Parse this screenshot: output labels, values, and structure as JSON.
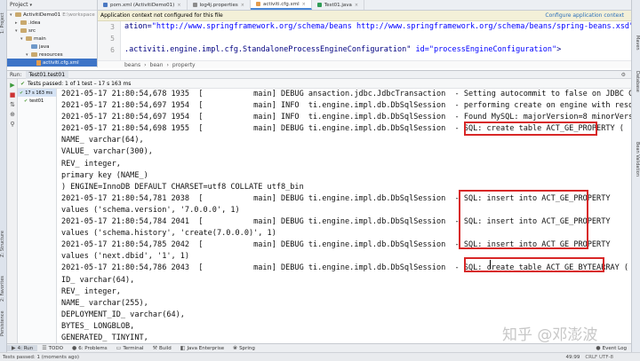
{
  "left_strip": {
    "top_tab": "1: Project",
    "structure_tab": "Z: Structure",
    "favorites_tab": "2: Favorites",
    "persistence_tab": "Persistence"
  },
  "right_strip": {
    "maven": "Maven",
    "database": "Database",
    "bean_validation": "Bean Validation"
  },
  "project": {
    "header": "Project",
    "tree": [
      {
        "label": "ActivitiDemo01",
        "dim": "E:\\workspace",
        "kind": "module",
        "arrow": "▾"
      },
      {
        "label": ".idea",
        "kind": "folder",
        "arrow": "▸"
      },
      {
        "label": "src",
        "kind": "folder",
        "arrow": "▾"
      },
      {
        "label": "main",
        "kind": "folder",
        "arrow": "▾"
      },
      {
        "label": "java",
        "kind": "blue",
        "arrow": ""
      },
      {
        "label": "resources",
        "kind": "folder",
        "arrow": "▾"
      },
      {
        "label": "activiti.cfg.xml",
        "kind": "file",
        "arrow": "",
        "selected": true
      }
    ]
  },
  "tabs": [
    {
      "label": "pom.xml (ActivitiDemo01)",
      "color": "#4a78c2"
    },
    {
      "label": "log4j.properties",
      "color": "#8c8c8c"
    },
    {
      "label": "activiti.cfg.xml",
      "color": "#e59c4b",
      "active": true
    },
    {
      "label": "Test01.java",
      "color": "#2f9c56"
    }
  ],
  "notice": {
    "text": "Application context not configured for this file",
    "link": "Configure application context"
  },
  "editor": {
    "gutter": [
      "3",
      "5",
      "6"
    ],
    "lines": [
      {
        "pre": "ation=",
        "str": "\"http://www.springframework.org/schema/beans http://www.springframework.org/schema/beans/spring-beans.xsd\"",
        "post": ">"
      },
      {
        "pre": "",
        "str": "",
        "post": ""
      },
      {
        "pre": ".activiti.engine.impl.cfg.StandaloneProcessEngineConfiguration\" ",
        "str": "id=\"processEngineConfiguration\"",
        "post": ">"
      }
    ],
    "breadcrumb": [
      "beans",
      "bean",
      "property"
    ]
  },
  "run": {
    "title": "Run:",
    "tab": "Test01.test01",
    "status": "Tests passed: 1 of 1 test – 17 s 163 ms",
    "tree": [
      {
        "label": "17 s 163 ms",
        "selected": true
      },
      {
        "label": "test01"
      }
    ],
    "console": [
      "2021-05-17 21:80:54,678 1935  [           main] DEBUG ansaction.jdbc.JdbcTransaction  - Setting autocommit to false on JDBC Conn",
      "2021-05-17 21:80:54,697 1954  [           main] INFO  ti.engine.impl.db.DbSqlSession  - performing create on engine with resource",
      "2021-05-17 21:80:54,697 1954  [           main] INFO  ti.engine.impl.db.DbSqlSession  - Found MySQL: majorVersion=8 minorVersion",
      "2021-05-17 21:80:54,698 1955  [           main] DEBUG ti.engine.impl.db.DbSqlSession  - SQL: create table ACT_GE_PROPERTY (",
      "NAME_ varchar(64),",
      "VALUE_ varchar(300),",
      "REV_ integer,",
      "primary key (NAME_)",
      ") ENGINE=InnoDB DEFAULT CHARSET=utf8 COLLATE utf8_bin",
      "2021-05-17 21:80:54,781 2038  [           main] DEBUG ti.engine.impl.db.DbSqlSession  - SQL: insert into ACT_GE_PROPERTY",
      "values ('schema.version', '7.0.0.0', 1)",
      "2021-05-17 21:80:54,784 2041  [           main] DEBUG ti.engine.impl.db.DbSqlSession  - SQL: insert into ACT_GE_PROPERTY",
      "values ('schema.history', 'create(7.0.0.0)', 1)",
      "2021-05-17 21:80:54,785 2042  [           main] DEBUG ti.engine.impl.db.DbSqlSession  - SQL: insert into ACT_GE_PROPERTY",
      "values ('next.dbid', '1', 1)",
      "2021-05-17 21:80:54,786 2043  [           main] DEBUG ti.engine.impl.db.DbSqlSession  - SQL: create table ACT_GE_BYTEARRAY (",
      "ID_ varchar(64),",
      "REV_ integer,",
      "NAME_ varchar(255),",
      "DEPLOYMENT_ID_ varchar(64),",
      "BYTES_ LONGBLOB,",
      "GENERATED_ TINYINT,",
      "primary key (ID_)"
    ]
  },
  "watermark": "知乎 @邓澎波",
  "bottom_tabs": [
    {
      "label": "4: Run",
      "icon": "▶",
      "active": true
    },
    {
      "label": "TODO",
      "icon": "☰"
    },
    {
      "label": "6: Problems",
      "icon": "●"
    },
    {
      "label": "Terminal",
      "icon": "▭"
    },
    {
      "label": "Build",
      "icon": "⚒"
    },
    {
      "label": "Java Enterprise",
      "icon": "◧"
    },
    {
      "label": "Spring",
      "icon": "❀"
    },
    {
      "label": "Event Log",
      "icon": "●",
      "right": true
    }
  ],
  "status_bar": {
    "message": "Tests passed: 1 (moments ago)",
    "position": "49:99",
    "encoding": "CRLF  UTF-8"
  },
  "colors": {
    "accent": "#3d74c7",
    "highlight_box": "#d82727",
    "pass": "#4f9a3a"
  }
}
